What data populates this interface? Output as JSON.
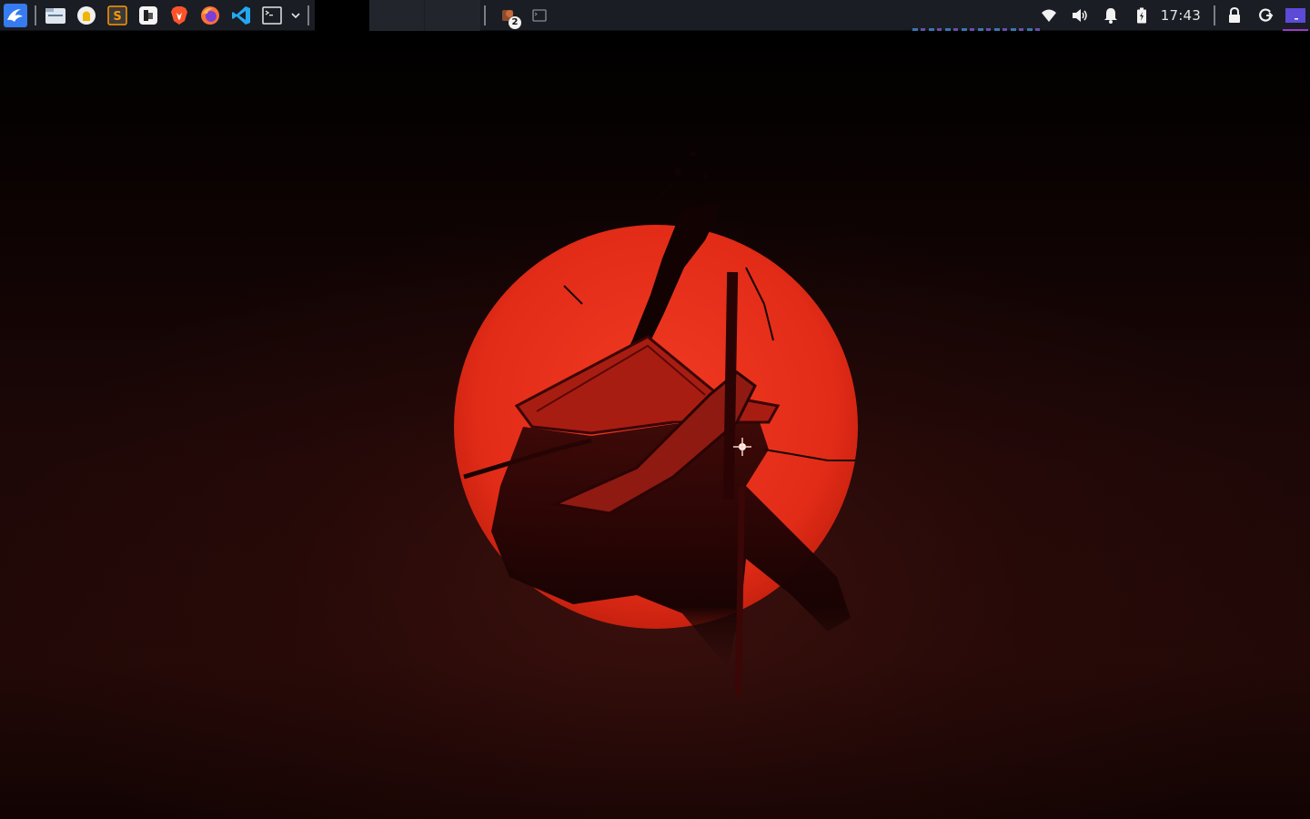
{
  "panel": {
    "launchers": [
      {
        "name": "app-menu-icon"
      },
      {
        "name": "file-manager-icon"
      },
      {
        "name": "keepassxc-icon"
      },
      {
        "name": "sublime-text-icon"
      },
      {
        "name": "office-icon"
      },
      {
        "name": "brave-browser-icon"
      },
      {
        "name": "firefox-icon"
      },
      {
        "name": "vscode-icon"
      },
      {
        "name": "terminal-icon"
      },
      {
        "name": "chevron-down-icon"
      }
    ],
    "tasks": [
      {
        "name": "task-window-1"
      },
      {
        "name": "task-window-2"
      },
      {
        "name": "task-window-3"
      }
    ],
    "grouped_task": {
      "icon": "grouped-apps-icon",
      "count": "2"
    },
    "show_desktop_icon": "window-icon",
    "tray": {
      "wifi_icon": "wifi-icon",
      "volume_icon": "volume-icon",
      "notifications_icon": "bell-icon",
      "battery_icon": "battery-icon",
      "clock": "17:43",
      "lock_icon": "lock-icon",
      "logout_icon": "power-refresh-icon",
      "desktop_pager_icon": "desktop-pager-icon"
    }
  },
  "wallpaper": {
    "subject": "samurai-wallpaper",
    "sun_color": "#e8301c",
    "background_color": "#1e0807"
  }
}
